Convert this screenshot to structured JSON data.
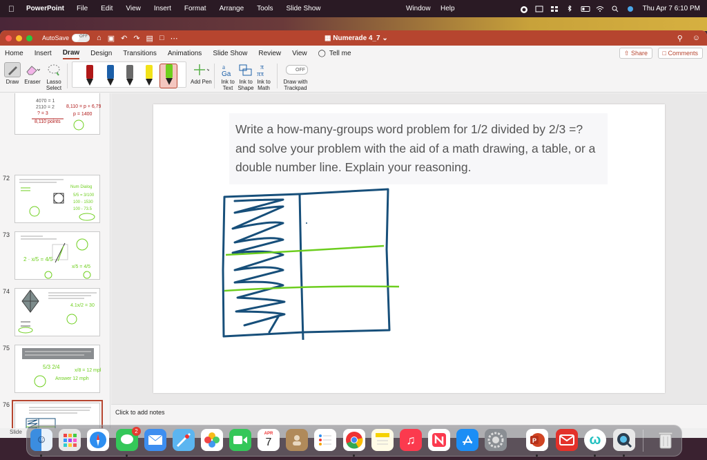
{
  "menubar": {
    "app_name": "PowerPoint",
    "menus": [
      "File",
      "Edit",
      "View",
      "Insert",
      "Format",
      "Arrange",
      "Tools",
      "Slide Show"
    ],
    "window_menu": "Window",
    "help_menu": "Help",
    "datetime": "Thu Apr 7  6:10 PM"
  },
  "titlebar": {
    "autosave_label": "AutoSave",
    "autosave_state": "OFF",
    "document_title": "Numerade 4_7"
  },
  "ribbon_tabs": [
    "Home",
    "Insert",
    "Draw",
    "Design",
    "Transitions",
    "Animations",
    "Slide Show",
    "Review",
    "View"
  ],
  "active_tab": "Draw",
  "tell_me": "Tell me",
  "share_label": "Share",
  "comments_label": "Comments",
  "ribbon": {
    "draw_label": "Draw",
    "eraser_label": "Eraser",
    "lasso_label": "Lasso\nSelect",
    "lasso_line1": "Lasso",
    "lasso_line2": "Select",
    "add_pen_label": "Add Pen",
    "ink_text_1": "Ink to",
    "ink_text_2": "Text",
    "ink_shape_1": "Ink to",
    "ink_shape_2": "Shape",
    "ink_math_1": "Ink to",
    "ink_math_2": "Math",
    "trackpad_state": "OFF",
    "trackpad_1": "Draw with",
    "trackpad_2": "Trackpad",
    "pen_colors": [
      "#b01818",
      "#1c5fa8",
      "#555555",
      "#f2e21a",
      "#6ecf1d"
    ]
  },
  "thumbnails": [
    {
      "number": "72"
    },
    {
      "number": "73"
    },
    {
      "number": "74"
    },
    {
      "number": "75"
    },
    {
      "number": "76"
    }
  ],
  "slide": {
    "question": "Write a how-many-groups word problem for 1/2 divided by 2/3 =? and solve your problem with the aid of a math drawing, a table, or a double number line. Explain your reasoning.",
    "ink_colors": {
      "box": "#174f7a",
      "lines": "#6ccd1e"
    }
  },
  "notes_placeholder": "Click to add notes",
  "status_left": "Slide",
  "dock": {
    "calendar_month": "APR",
    "calendar_day": "7",
    "messages_badge": "2"
  }
}
